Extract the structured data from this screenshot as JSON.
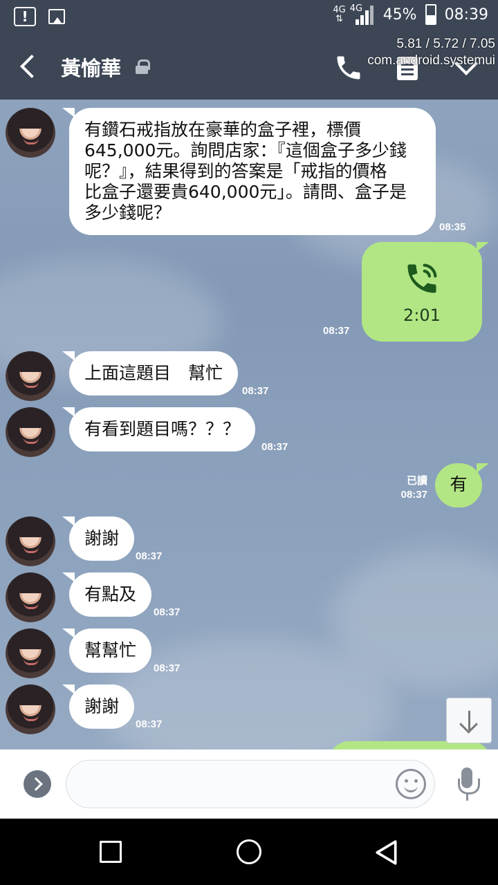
{
  "status_bar": {
    "network_top": "4G",
    "network_signal": "4G",
    "battery": "45%",
    "time": "08:39",
    "icons": [
      "alert-icon",
      "image-icon",
      "signal-icon",
      "battery-icon"
    ]
  },
  "overlay": {
    "load": "5.81 / 5.72 / 7.05",
    "process": "com.android.systemui"
  },
  "header": {
    "contact_name": "黃愉華",
    "icons": [
      "back-icon",
      "lock-icon",
      "phone-icon",
      "note-icon",
      "chevron-down-icon"
    ]
  },
  "messages": [
    {
      "direction": "in",
      "text": "有鑽石戒指放在豪華的盒子裡，標價\n645,000元。詢問店家：『這個盒子多少錢\n呢？』，結果得到的答案是「戒指的價格\n比盒子還要貴640,000元」。請問、盒子是\n多少錢呢？",
      "time": "08:35"
    },
    {
      "direction": "out",
      "type": "call",
      "duration": "2:01",
      "time": "08:37"
    },
    {
      "direction": "in",
      "text": "上面這題目　幫忙",
      "time": "08:37"
    },
    {
      "direction": "in",
      "text": "有看到題目嗎？？？",
      "time": "08:37"
    },
    {
      "direction": "out",
      "text": "有",
      "read": "已讀",
      "time": "08:37"
    },
    {
      "direction": "in",
      "text": "謝謝",
      "time": "08:37"
    },
    {
      "direction": "in",
      "text": "有點及",
      "time": "08:37"
    },
    {
      "direction": "in",
      "text": "幫幫忙",
      "time": "08:37"
    },
    {
      "direction": "in",
      "text": "謝謝",
      "time": "08:37"
    }
  ],
  "input": {
    "placeholder": ""
  },
  "colors": {
    "header_bg": "#3c4655",
    "outgoing_bubble": "#b2e684",
    "incoming_bubble": "#ffffff",
    "call_icon": "#1e5a1e"
  }
}
